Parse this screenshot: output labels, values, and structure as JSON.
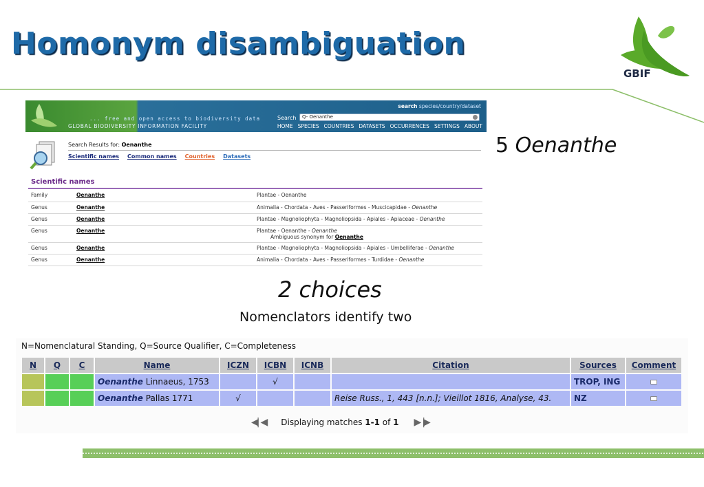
{
  "slide": {
    "title": "Homonym disambiguation",
    "logo_text": "GBIF",
    "oenanthe_count": "5",
    "oenanthe_word": "Oenanthe",
    "choices": "2 choices",
    "nomenclators": "Nomenclators identify two"
  },
  "portal": {
    "tagline": "... free and open access to biodiversity data",
    "org": "GLOBAL BIODIVERSITY INFORMATION FACILITY",
    "top_search": "search",
    "top_search_hint": "species/country/dataset",
    "search_label": "Search",
    "search_value": "Q- Oenanthe",
    "nav": [
      "HOME",
      "SPECIES",
      "COUNTRIES",
      "DATASETS",
      "OCCURRENCES",
      "SETTINGS",
      "ABOUT"
    ],
    "results_for_label": "Search Results for:",
    "results_for_term": "Oenanthe",
    "tabs": [
      {
        "label": "Scientific names",
        "color": "#1a2a7a"
      },
      {
        "label": "Common names",
        "color": "#1a2a7a"
      },
      {
        "label": "Countries",
        "color": "#e0602a"
      },
      {
        "label": "Datasets",
        "color": "#2a6ab8"
      }
    ],
    "section_title": "Scientific names",
    "rows": [
      {
        "rank": "Family",
        "name": "Oenanthe",
        "path": "Plantae - Oenanthe",
        "path_em": "",
        "sub_label": "",
        "sub_name": ""
      },
      {
        "rank": "Genus",
        "name": "Oenanthe",
        "path": "Animalia - Chordata - Aves - Passeriformes - Muscicapidae - ",
        "path_em": "Oenanthe",
        "sub_label": "",
        "sub_name": ""
      },
      {
        "rank": "Genus",
        "name": "Oenanthe",
        "path": "Plantae - Magnoliophyta - Magnoliopsida - Apiales - Apiaceae - ",
        "path_em": "Oenanthe",
        "sub_label": "",
        "sub_name": ""
      },
      {
        "rank": "Genus",
        "name": "Oenanthe",
        "path": "Plantae - Oenanthe - ",
        "path_em": "Oenanthe",
        "sub_label": "Ambiguous synonym for",
        "sub_name": "Oenanthe"
      },
      {
        "rank": "Genus",
        "name": "Oenanthe",
        "path": "Plantae - Magnoliophyta - Magnoliopsida - Apiales - Umbelliferae - ",
        "path_em": "Oenanthe",
        "sub_label": "",
        "sub_name": ""
      },
      {
        "rank": "Genus",
        "name": "Oenanthe",
        "path": "Animalia - Chordata - Aves - Passeriformes - Turdidae - ",
        "path_em": "Oenanthe",
        "sub_label": "",
        "sub_name": ""
      }
    ]
  },
  "ipni": {
    "legend": "N=Nomenclatural Standing, Q=Source Qualifier, C=Completeness",
    "headers": [
      "N",
      "Q",
      "C",
      "Name",
      "ICZN",
      "ICBN",
      "ICNB",
      "Citation",
      "Sources",
      "Comment"
    ],
    "rows": [
      {
        "genus": "Oenanthe",
        "author": " Linnaeus, 1753",
        "iczn": "",
        "icbn": "√",
        "icnb": "",
        "citation": "",
        "sources": "TROP, ING"
      },
      {
        "genus": "Oenanthe",
        "author": " Pallas 1771",
        "iczn": "√",
        "icbn": "",
        "icnb": "",
        "citation": "Reise Russ., 1, 443 [n.n.]; Vieillot 1816, Analyse, 43.",
        "sources": "NZ"
      }
    ],
    "pager": {
      "prefix": "Displaying matches ",
      "range": "1-1",
      "of": " of ",
      "total": "1"
    }
  },
  "colors": {
    "title_blue": "#1e6aa8",
    "gbif_green": "#5aaa2a",
    "row_blue": "#aeb8f4",
    "n_olive": "#b7c55a",
    "qc_green": "#57cf57"
  }
}
